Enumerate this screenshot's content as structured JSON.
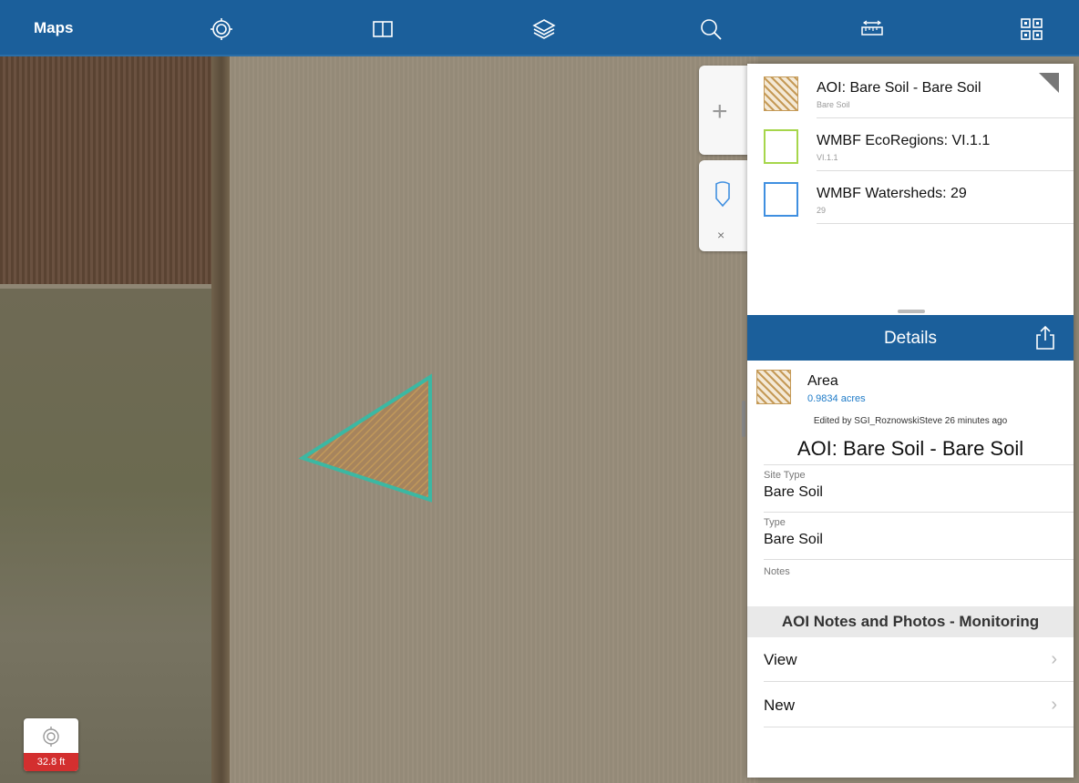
{
  "toolbar": {
    "title": "Maps",
    "icons": [
      "gps-icon",
      "map-book-icon",
      "layers-icon",
      "search-icon",
      "measure-icon",
      "qr-scan-icon"
    ]
  },
  "map": {
    "scale_label": "32.8 ft",
    "polygon_color": "#3bb8a3",
    "polygon_fill": "#c59a57"
  },
  "layers": [
    {
      "name": "AOI: Bare Soil - Bare Soil",
      "sub": "Bare Soil",
      "swatch": "hatch"
    },
    {
      "name": "WMBF EcoRegions: VI.1.1",
      "sub": "VI.1.1",
      "swatch": "#a6d64b"
    },
    {
      "name": "WMBF Watersheds: 29",
      "sub": "29",
      "swatch": "#3f8fe0"
    }
  ],
  "details": {
    "header": "Details",
    "area_label": "Area",
    "area_value": "0.9834 acres",
    "edited": "Edited by SGI_RoznowskiSteve 26 minutes ago",
    "feature_title": "AOI: Bare Soil - Bare Soil",
    "fields": [
      {
        "label": "Site Type",
        "value": "Bare Soil"
      },
      {
        "label": "Type",
        "value": "Bare Soil"
      },
      {
        "label": "Notes",
        "value": ""
      }
    ],
    "section": "AOI Notes and Photos - Monitoring",
    "actions": [
      "View",
      "New"
    ]
  },
  "colors": {
    "brand": "#1b5f9b",
    "scale_badge": "#d32f2f",
    "link": "#1e7bc8"
  }
}
